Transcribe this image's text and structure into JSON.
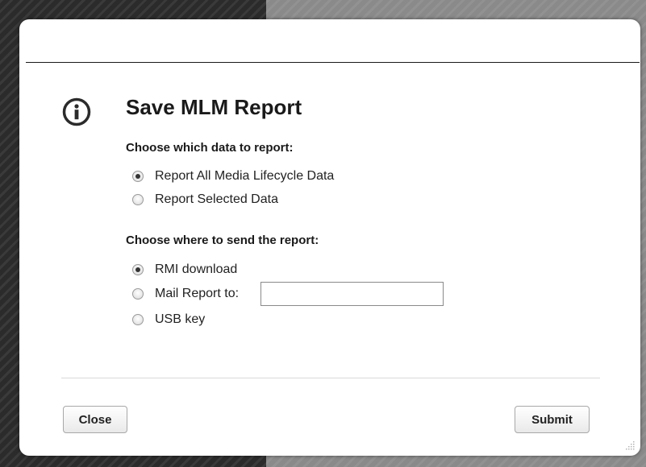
{
  "dialog": {
    "title": "Save MLM Report",
    "icon": "info-icon",
    "data_section": {
      "label": "Choose which data to report:",
      "options": [
        {
          "label": "Report All Media Lifecycle Data",
          "selected": true
        },
        {
          "label": "Report Selected Data",
          "selected": false
        }
      ]
    },
    "destination_section": {
      "label": "Choose where to send the report:",
      "options": [
        {
          "label": "RMI download",
          "selected": true
        },
        {
          "label": "Mail Report to:",
          "selected": false
        },
        {
          "label": "USB key",
          "selected": false
        }
      ],
      "mail_input_value": ""
    },
    "buttons": {
      "close_label": "Close",
      "submit_label": "Submit"
    }
  }
}
